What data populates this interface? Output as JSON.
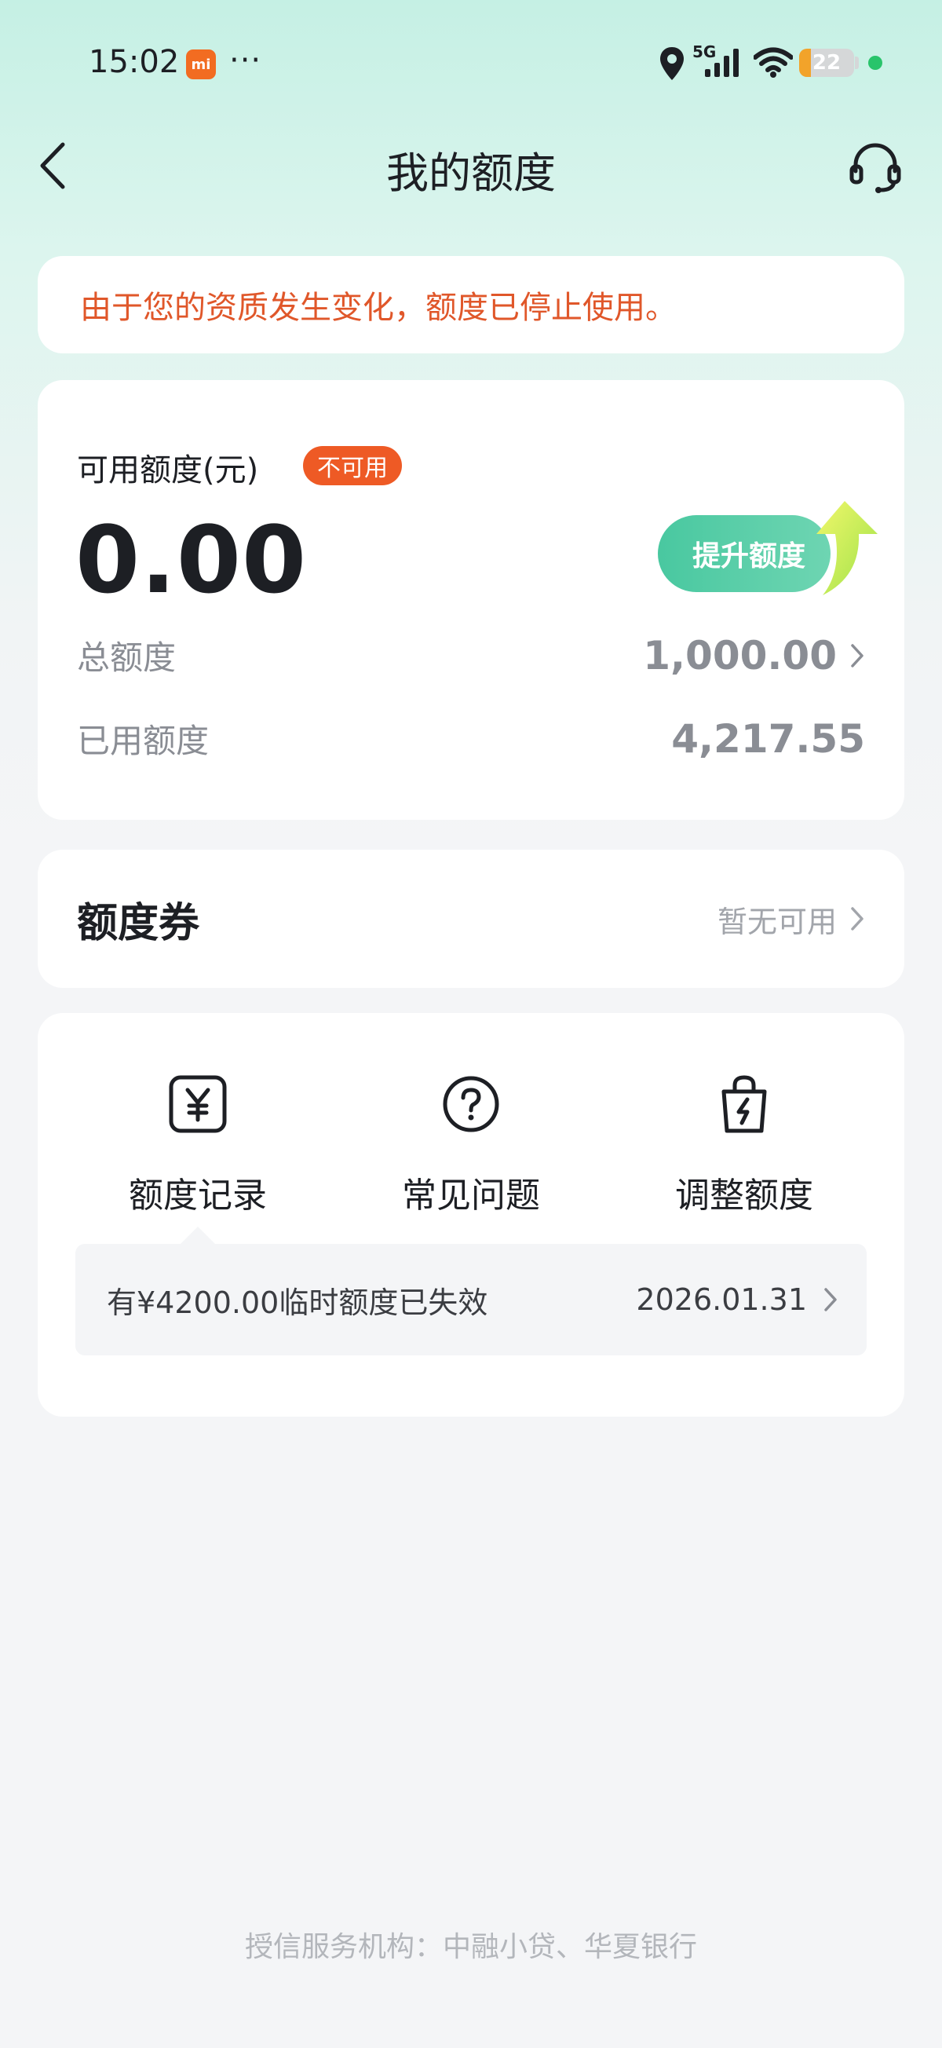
{
  "status_bar": {
    "time": "15:02",
    "mi_label": "mi",
    "dots": "···",
    "network": "5G",
    "battery": "22",
    "battery_level": 0.22
  },
  "nav": {
    "title": "我的额度"
  },
  "notice": {
    "text": "由于您的资质发生变化，额度已停止使用。"
  },
  "quota": {
    "label": "可用额度(元)",
    "badge": "不可用",
    "value": "0.00",
    "raise_button": "提升额度",
    "total_label": "总额度",
    "total_value": "1,000.00",
    "used_label": "已用额度",
    "used_value": "4,217.55"
  },
  "coupon": {
    "title": "额度券",
    "status": "暂无可用"
  },
  "actions": {
    "items": [
      {
        "label": "额度记录",
        "icon": "yuan-record-icon"
      },
      {
        "label": "常见问题",
        "icon": "question-icon"
      },
      {
        "label": "调整额度",
        "icon": "bag-lightning-icon"
      }
    ],
    "temp_text": "有¥4200.00临时额度已失效",
    "temp_date": "2026.01.31"
  },
  "footer": {
    "text": "授信服务机构：中融小贷、华夏银行"
  },
  "colors": {
    "accent": "#49c8a0",
    "warning": "#e0572a",
    "badge": "#ee5a25"
  }
}
